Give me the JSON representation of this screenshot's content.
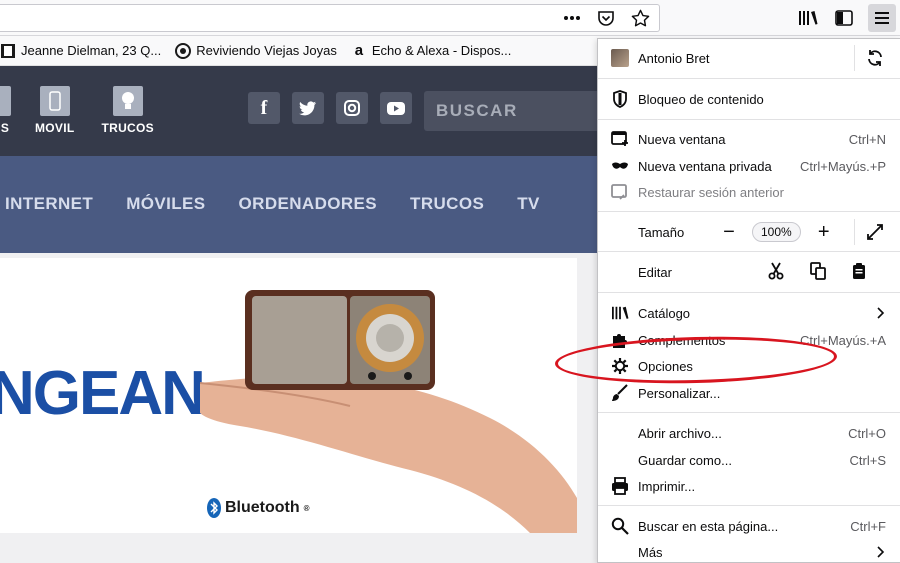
{
  "browser": {
    "bookmarks": [
      {
        "icon": "film-icon",
        "label": "Jeanne Dielman, 23 Q..."
      },
      {
        "icon": "reel-icon",
        "label": "Reviviendo Viejas Joyas"
      },
      {
        "icon": "amazon-icon",
        "label": "Echo & Alexa - Dispos..."
      }
    ],
    "amazon_glyph": "a"
  },
  "site": {
    "icons": [
      {
        "label": "S"
      },
      {
        "label": "MOVIL"
      },
      {
        "label": "TRUCOS"
      }
    ],
    "social": [
      "f",
      "t",
      "ig",
      "yt"
    ],
    "search_placeholder": "BUSCAR",
    "nav": [
      "INTERNET",
      "MÓVILES",
      "ORDENADORES",
      "TRUCOS",
      "TV"
    ],
    "brand_text": "NGEAN",
    "bluetooth_label": "Bluetooth",
    "bluetooth_mark": "®"
  },
  "menu": {
    "profile": "Antonio Bret",
    "content_blocking": "Bloqueo de contenido",
    "new_window": {
      "label": "Nueva ventana",
      "shortcut": "Ctrl+N"
    },
    "private_window": {
      "label": "Nueva ventana privada",
      "shortcut": "Ctrl+Mayús.+P"
    },
    "restore_session": {
      "label": "Restaurar sesión anterior"
    },
    "zoom": {
      "label": "Tamaño",
      "value": "100%",
      "minus": "−",
      "plus": "+"
    },
    "edit": {
      "label": "Editar"
    },
    "library": {
      "label": "Catálogo"
    },
    "addons": {
      "label": "Complementos",
      "shortcut": "Ctrl+Mayús.+A"
    },
    "options": {
      "label": "Opciones"
    },
    "customize": {
      "label": "Personalizar..."
    },
    "open_file": {
      "label": "Abrir archivo...",
      "shortcut": "Ctrl+O"
    },
    "save_as": {
      "label": "Guardar como...",
      "shortcut": "Ctrl+S"
    },
    "print": {
      "label": "Imprimir..."
    },
    "find": {
      "label": "Buscar en esta página...",
      "shortcut": "Ctrl+F"
    },
    "more": {
      "label": "Más"
    }
  },
  "colors": {
    "annotation": "#d8151f",
    "site_header": "#353a4a",
    "site_nav": "#4a5a82",
    "brand": "#1b4fa5"
  }
}
